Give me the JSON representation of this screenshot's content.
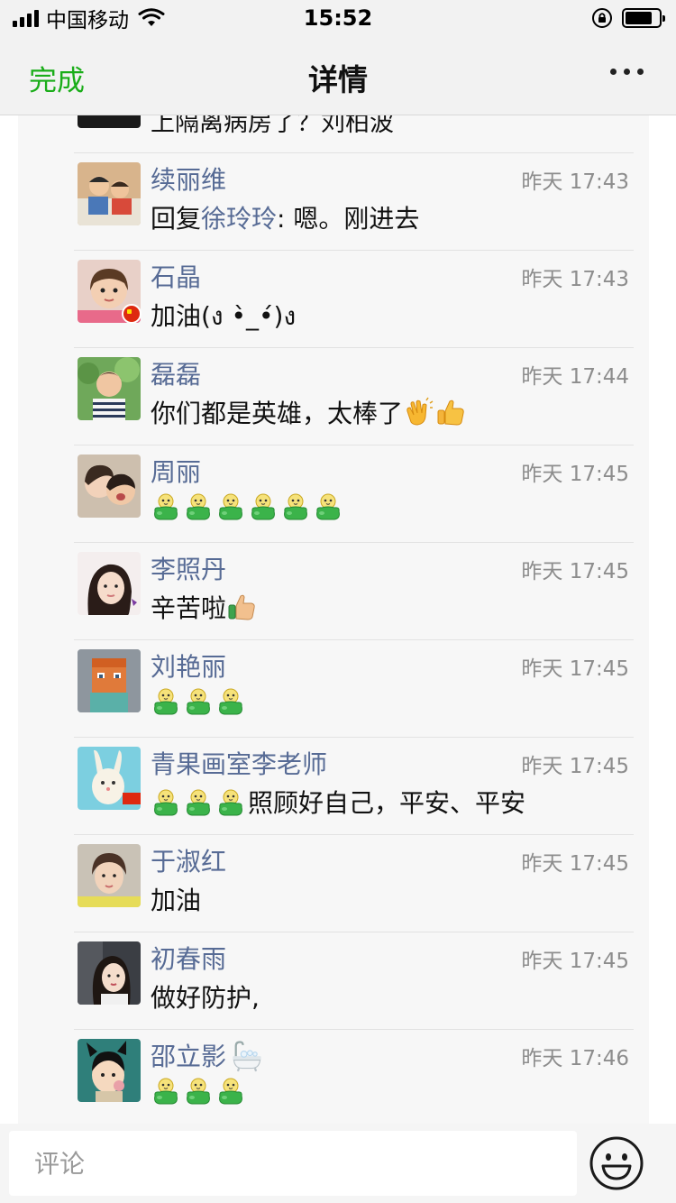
{
  "status_bar": {
    "carrier": "中国移动",
    "time": "15:52",
    "battery_level_percent": 80
  },
  "nav": {
    "done_label": "完成",
    "title": "详情"
  },
  "partial_comment": {
    "text": "上隔离病房了？刘柏波"
  },
  "comments": [
    {
      "name": "续丽维",
      "time": "昨天 17:43",
      "reply_prefix": "回复",
      "reply_to": "徐玲玲",
      "text": ": 嗯。刚进去"
    },
    {
      "name": "石晶",
      "time": "昨天 17:43",
      "text": "加油(ง •̀_•́)ง"
    },
    {
      "name": "磊磊",
      "time": "昨天 17:44",
      "text": "你们都是英雄，太棒了"
    },
    {
      "name": "周丽",
      "time": "昨天 17:45",
      "text": ""
    },
    {
      "name": "李照丹",
      "time": "昨天 17:45",
      "text": "辛苦啦"
    },
    {
      "name": "刘艳丽",
      "time": "昨天 17:45",
      "text": ""
    },
    {
      "name": "青果画室李老师",
      "time": "昨天 17:45",
      "text": "照顾好自己，平安、平安"
    },
    {
      "name": "于淑红",
      "time": "昨天 17:45",
      "text": "加油"
    },
    {
      "name": "初春雨",
      "time": "昨天 17:45",
      "text": "做好防护,"
    },
    {
      "name": "邵立影",
      "time": "昨天 17:46",
      "text": ""
    }
  ],
  "icons": {
    "more": "more-dots-icon",
    "emoji_button": "smiley-face-icon",
    "sticker": "green-sprout-emoji",
    "clap": "clapping-hands-emoji",
    "thumbs_up": "thumbs-up-emoji",
    "bathtub": "bathtub-emoji"
  },
  "input": {
    "placeholder": "评论"
  },
  "colors": {
    "accent_green": "#1aad19",
    "name_link": "#576b95",
    "timestamp": "#8d8d8d"
  }
}
